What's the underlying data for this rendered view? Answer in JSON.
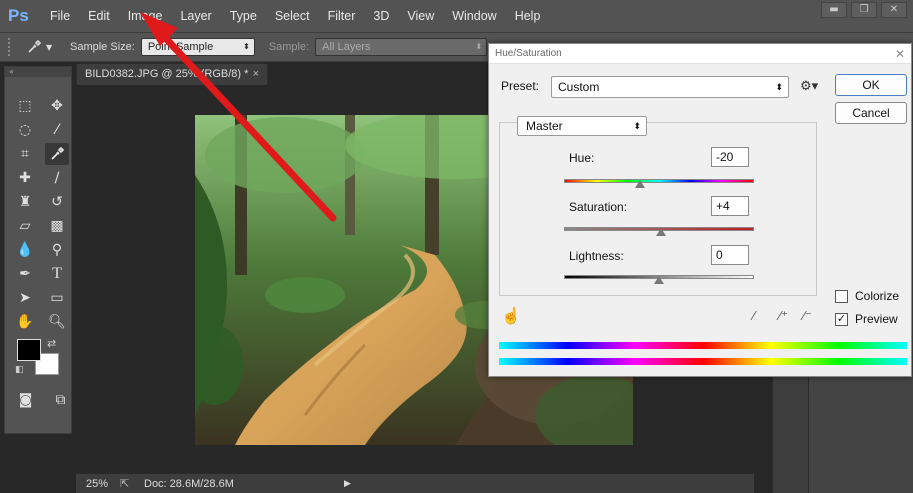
{
  "menu": {
    "logo": "Ps",
    "items": [
      "File",
      "Edit",
      "Image",
      "Layer",
      "Type",
      "Select",
      "Filter",
      "3D",
      "View",
      "Window",
      "Help"
    ]
  },
  "window_controls": {
    "minimize": "▬",
    "maximize": "❐",
    "close": "✕"
  },
  "options": {
    "sample_size_label": "Sample Size:",
    "sample_size_value": "Point Sample",
    "sample_label": "Sample:",
    "sample_value": "All Layers"
  },
  "document": {
    "tab_title": "BILD0382.JPG @ 25% (RGB/8) *",
    "tab_close": "×"
  },
  "status": {
    "zoom": "25%",
    "doc": "Doc: 28.6M/28.6M",
    "arrow": "▶"
  },
  "dialog": {
    "title": "Hue/Saturation",
    "close": "✕",
    "preset_label": "Preset:",
    "preset_value": "Custom",
    "ok_label": "OK",
    "cancel_label": "Cancel",
    "channel_value": "Master",
    "hue_label": "Hue:",
    "hue_value": "-20",
    "hue_fraction": 0.4,
    "saturation_label": "Saturation:",
    "saturation_value": "+4",
    "saturation_fraction": 0.51,
    "lightness_label": "Lightness:",
    "lightness_value": "0",
    "lightness_fraction": 0.5,
    "colorize_label": "Colorize",
    "colorize_checked": false,
    "preview_label": "Preview",
    "preview_checked": true
  },
  "colors": {
    "ui_dark": "#535353",
    "canvas_bg": "#282828",
    "dialog_bg": "#f0f0f0",
    "arrow_red": "#e01a1a",
    "foreground_swatch": "#000000",
    "background_swatch": "#ffffff"
  },
  "icons": {
    "eyedropper": "eyedropper-icon",
    "gear": "gear-icon",
    "hand": "hand-adjust-icon"
  }
}
